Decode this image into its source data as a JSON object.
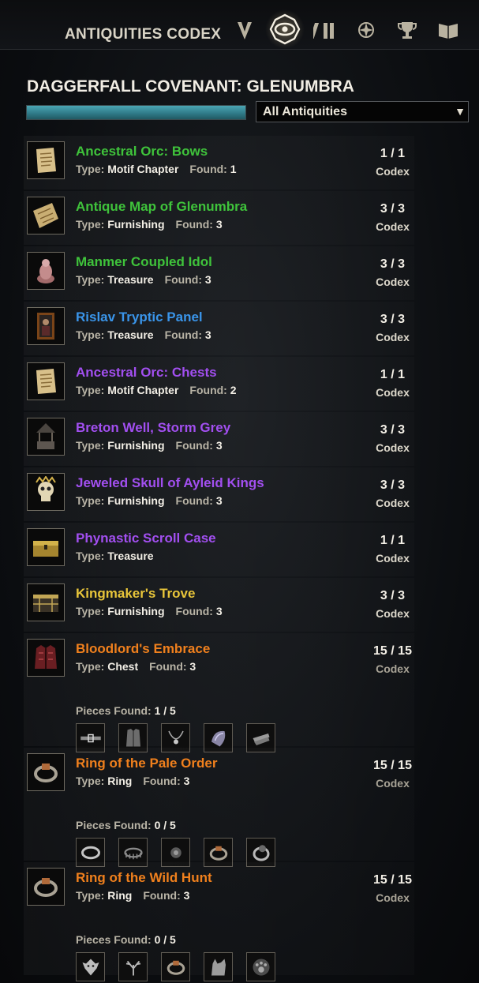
{
  "header": {
    "title": "ANTIQUITIES CODEX",
    "icons": [
      "tracker-icon",
      "codex-eye-icon",
      "journal-books-icon",
      "compass-star-icon",
      "trophy-icon",
      "open-book-icon"
    ],
    "active_icon": "codex-eye-icon"
  },
  "zone": {
    "title": "DAGGERFALL COVENANT: GLENUMBRA",
    "progress_percent": 100,
    "filter_label": "All Antiquities"
  },
  "labels": {
    "type": "Type:",
    "found": "Found:",
    "pieces_found": "Pieces Found:"
  },
  "colors": {
    "green": "#3fc33b",
    "blue": "#3a95ea",
    "purple": "#a24ff0",
    "gold": "#e8c53a",
    "orange": "#f0801d"
  },
  "antiquities": [
    {
      "name": "Ancestral Orc: Bows",
      "color": "#3fc33b",
      "type": "Motif Chapter",
      "found": "1",
      "count": "1 / 1",
      "codex": "Codex",
      "icon": "parchment-icon"
    },
    {
      "name": "Antique Map of Glenumbra",
      "color": "#3fc33b",
      "type": "Furnishing",
      "found": "3",
      "count": "3 / 3",
      "codex": "Codex",
      "icon": "map-scroll-icon"
    },
    {
      "name": "Manmer Coupled Idol",
      "color": "#3fc33b",
      "type": "Treasure",
      "found": "3",
      "count": "3 / 3",
      "codex": "Codex",
      "icon": "idol-icon"
    },
    {
      "name": "Rislav Tryptic Panel",
      "color": "#3a95ea",
      "type": "Treasure",
      "found": "3",
      "count": "3 / 3",
      "codex": "Codex",
      "icon": "portrait-panel-icon"
    },
    {
      "name": "Ancestral Orc: Chests",
      "color": "#a24ff0",
      "type": "Motif Chapter",
      "found": "2",
      "count": "1 / 1",
      "codex": "Codex",
      "icon": "parchment-icon"
    },
    {
      "name": "Breton Well, Storm Grey",
      "color": "#a24ff0",
      "type": "Furnishing",
      "found": "3",
      "count": "3 / 3",
      "codex": "Codex",
      "icon": "well-icon"
    },
    {
      "name": "Jeweled Skull of Ayleid Kings",
      "color": "#a24ff0",
      "type": "Furnishing",
      "found": "3",
      "count": "3 / 3",
      "codex": "Codex",
      "icon": "skull-icon"
    },
    {
      "name": "Phynastic Scroll Case",
      "color": "#a24ff0",
      "type": "Treasure",
      "found": null,
      "count": "1 / 1",
      "codex": "Codex",
      "icon": "chest-icon"
    },
    {
      "name": "Kingmaker's Trove",
      "color": "#e8c53a",
      "type": "Furnishing",
      "found": "3",
      "count": "3 / 3",
      "codex": "Codex",
      "icon": "trove-icon"
    }
  ],
  "sets": [
    {
      "name": "Bloodlord's Embrace",
      "color": "#f0801d",
      "type": "Chest",
      "found": "3",
      "count": "15 / 15",
      "codex": "Codex",
      "icon": "armor-chest-icon",
      "pieces": "1 / 5",
      "piece_icons": [
        "belt-icon",
        "cuirass-icon",
        "necklace-icon",
        "shoulder-icon",
        "greaves-icon"
      ]
    },
    {
      "name": "Ring of the Pale Order",
      "color": "#f0801d",
      "type": "Ring",
      "found": "3",
      "count": "15 / 15",
      "codex": "Codex",
      "icon": "ring-icon",
      "pieces": "0 / 5",
      "piece_icons": [
        "band-icon",
        "crown-icon",
        "gem-icon",
        "ring-icon",
        "signet-icon"
      ]
    },
    {
      "name": "Ring of the Wild Hunt",
      "color": "#f0801d",
      "type": "Ring",
      "found": "3",
      "count": "15 / 15",
      "codex": "Codex",
      "icon": "ring-icon",
      "pieces": "0 / 5",
      "piece_icons": [
        "wolf-head-icon",
        "antler-icon",
        "ring-icon",
        "wolf-icon",
        "paw-rune-icon"
      ]
    }
  ]
}
